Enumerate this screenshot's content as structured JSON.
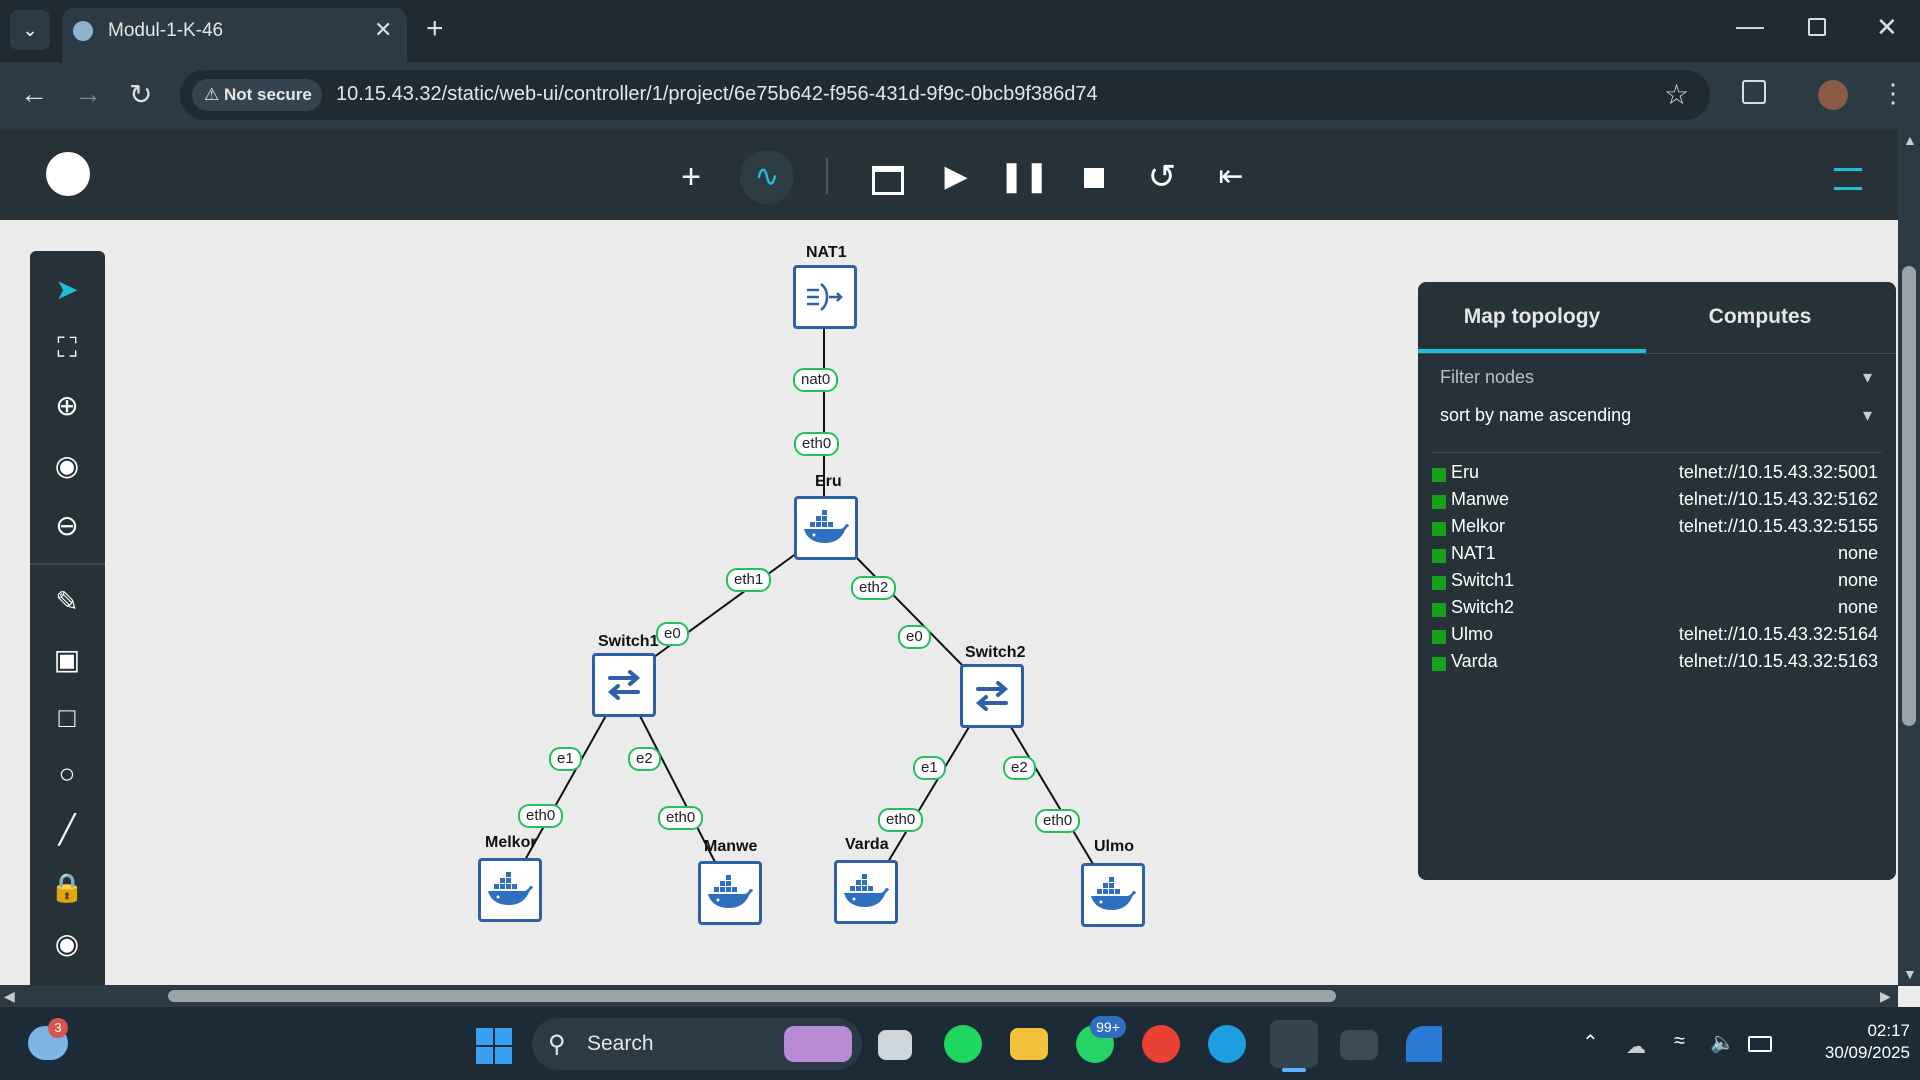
{
  "browser": {
    "tab_title": "Modul-1-K-46",
    "security_label": "Not secure",
    "url": "10.15.43.32/static/web-ui/controller/1/project/6e75b642-f956-431d-9f9c-0bcb9f386d74"
  },
  "topology": {
    "nodes": {
      "nat1": "NAT1",
      "eru": "Eru",
      "switch1": "Switch1",
      "switch2": "Switch2",
      "melkor": "Melkor",
      "manwe": "Manwe",
      "varda": "Varda",
      "ulmo": "Ulmo"
    },
    "interfaces": {
      "nat1_nat0": "nat0",
      "eru_eth0": "eth0",
      "eru_eth1": "eth1",
      "eru_eth2": "eth2",
      "sw1_e0": "e0",
      "sw1_e1": "e1",
      "sw1_e2": "e2",
      "sw2_e0": "e0",
      "sw2_e1": "e1",
      "sw2_e2": "e2",
      "melkor_eth0": "eth0",
      "manwe_eth0": "eth0",
      "varda_eth0": "eth0",
      "ulmo_eth0": "eth0"
    }
  },
  "panel": {
    "tab_map": "Map topology",
    "tab_computes": "Computes",
    "filter_label": "Filter nodes",
    "sort_label": "sort by name ascending",
    "status_color": "#17a018",
    "rows": [
      {
        "name": "Eru",
        "console": "telnet://10.15.43.32:5001"
      },
      {
        "name": "Manwe",
        "console": "telnet://10.15.43.32:5162"
      },
      {
        "name": "Melkor",
        "console": "telnet://10.15.43.32:5155"
      },
      {
        "name": "NAT1",
        "console": "none"
      },
      {
        "name": "Switch1",
        "console": "none"
      },
      {
        "name": "Switch2",
        "console": "none"
      },
      {
        "name": "Ulmo",
        "console": "telnet://10.15.43.32:5164"
      },
      {
        "name": "Varda",
        "console": "telnet://10.15.43.32:5163"
      }
    ]
  },
  "taskbar": {
    "search_placeholder": "Search",
    "weather_badge": "3",
    "whatsapp_badge": "99+",
    "time": "02:17",
    "date": "30/09/2025"
  },
  "colors": {
    "accent": "#1fc0d6",
    "node_border": "#2f5fa8",
    "link_label_border": "#23c05a",
    "toolbar_bg": "#263238"
  }
}
